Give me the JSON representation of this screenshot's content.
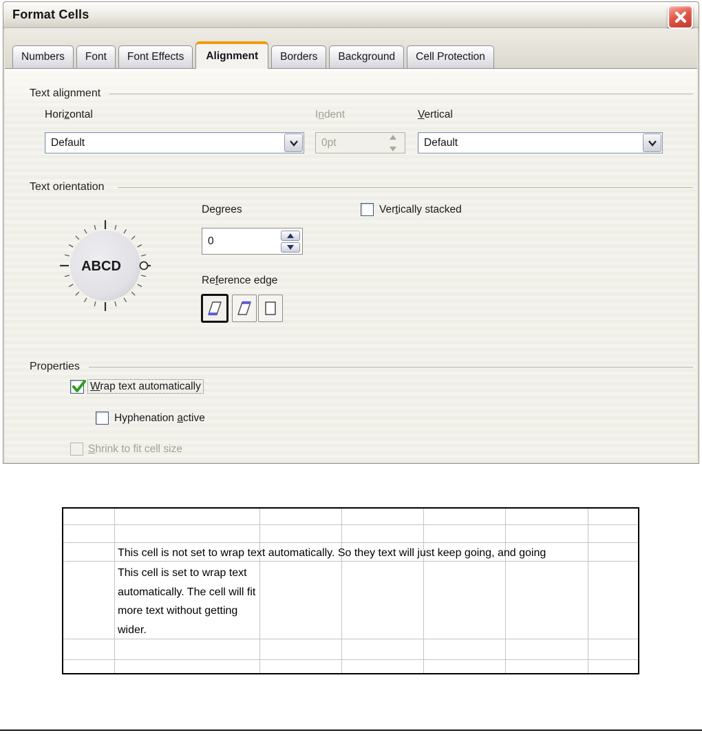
{
  "window": {
    "title": "Format Cells",
    "close_icon": "x-close"
  },
  "tabs": [
    {
      "label": "Numbers",
      "active": false
    },
    {
      "label": "Font",
      "active": false
    },
    {
      "label": "Font Effects",
      "active": false
    },
    {
      "label": "Alignment",
      "active": true
    },
    {
      "label": "Borders",
      "active": false
    },
    {
      "label": "Background",
      "active": false
    },
    {
      "label": "Cell Protection",
      "active": false
    }
  ],
  "text_alignment": {
    "caption": "Text alignment",
    "horizontal_label": {
      "pre": "Hori",
      "key": "z",
      "post": "ontal"
    },
    "horizontal_value": "Default",
    "indent_label": {
      "pre": "I",
      "key": "n",
      "post": "dent"
    },
    "indent_value": "0pt",
    "vertical_label": {
      "pre": "",
      "key": "V",
      "post": "ertical"
    },
    "vertical_value": "Default"
  },
  "text_orientation": {
    "caption": "Text orientation",
    "dial_text": "ABCD",
    "degrees_label": {
      "pre": "De",
      "key": "g",
      "post": "rees"
    },
    "degrees_value": "0",
    "reference_edge_label": {
      "pre": "Re",
      "key": "f",
      "post": "erence edge"
    },
    "vertically_stacked_label": {
      "pre": "Ver",
      "key": "t",
      "post": "ically stacked"
    },
    "vertically_stacked_checked": false
  },
  "properties": {
    "caption": "Properties",
    "wrap_label": {
      "pre": "",
      "key": "W",
      "post": "rap text automatically"
    },
    "wrap_checked": true,
    "hyphenation_label": {
      "pre": "Hyphenation ",
      "key": "a",
      "post": "ctive"
    },
    "hyphenation_checked": false,
    "shrink_label": {
      "pre": "",
      "key": "S",
      "post": "hrink to fit cell size"
    },
    "shrink_checked": false,
    "shrink_disabled": true
  },
  "spreadsheet": {
    "nowrap_text": "This cell is not set to wrap text automatically. So they text will just keep going, and going",
    "wrap_text": "This cell is set to wrap text automatically. The cell will fit more text without getting wider."
  }
}
